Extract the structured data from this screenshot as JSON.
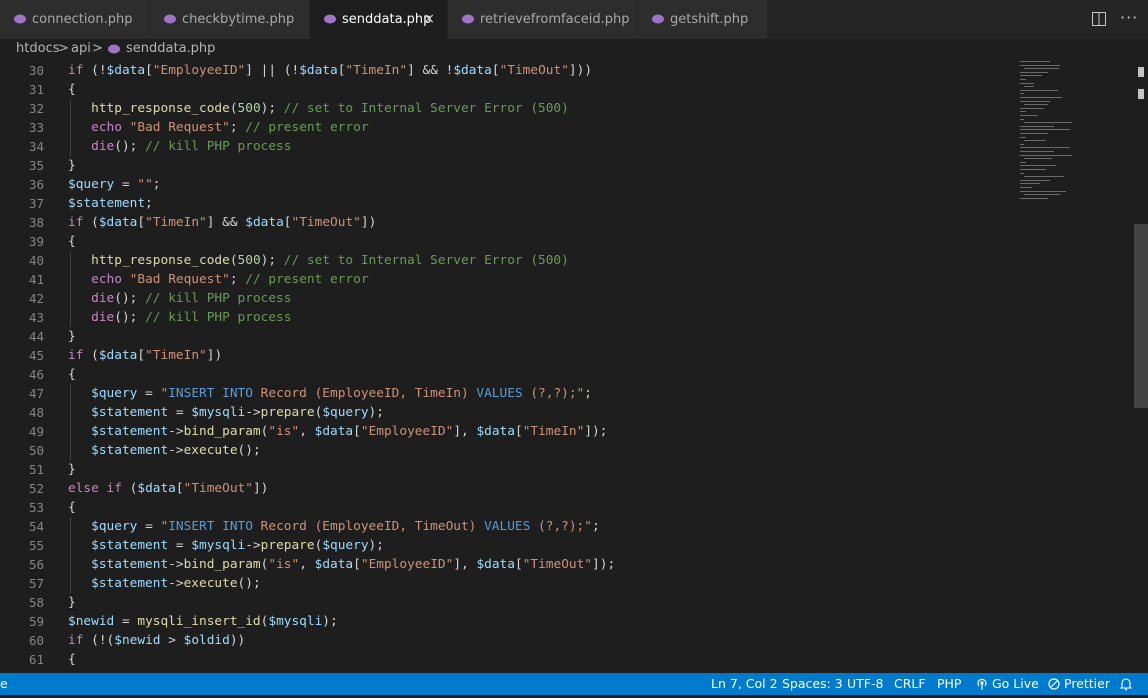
{
  "tabs": [
    {
      "label": "connection.php",
      "active": false
    },
    {
      "label": "checkbytime.php",
      "active": false
    },
    {
      "label": "senddata.php",
      "active": true
    },
    {
      "label": "retrievefromfaceid.php",
      "active": false
    },
    {
      "label": "getshift.php",
      "active": false
    }
  ],
  "tab_close_glyph": "×",
  "breadcrumb": {
    "folder1": "htdocs",
    "folder2": "api",
    "file": "senddata.php",
    "separator": ">"
  },
  "editor": {
    "line_numbers": [
      "30",
      "31",
      "32",
      "33",
      "34",
      "35",
      "36",
      "37",
      "38",
      "39",
      "40",
      "41",
      "42",
      "43",
      "44",
      "45",
      "46",
      "47",
      "48",
      "49",
      "50",
      "51",
      "52",
      "53",
      "54",
      "55",
      "56",
      "57",
      "58",
      "59",
      "60",
      "61"
    ]
  },
  "statusbar": {
    "left_text": "e",
    "position": "Ln 7, Col 2",
    "spaces": "Spaces: 3",
    "encoding": "UTF-8",
    "eol": "CRLF",
    "language": "PHP",
    "go_live": "Go Live",
    "prettier": "Prettier"
  },
  "colors": {
    "accent": "#007acc",
    "editor_bg": "#1e1e1e",
    "tab_bg": "#2d2d2d",
    "php_icon": "#a074c4"
  },
  "icons": {
    "file": "php-elephant-icon",
    "split": "split-editor-icon",
    "more": "more-actions-icon",
    "bell": "bell-icon"
  }
}
